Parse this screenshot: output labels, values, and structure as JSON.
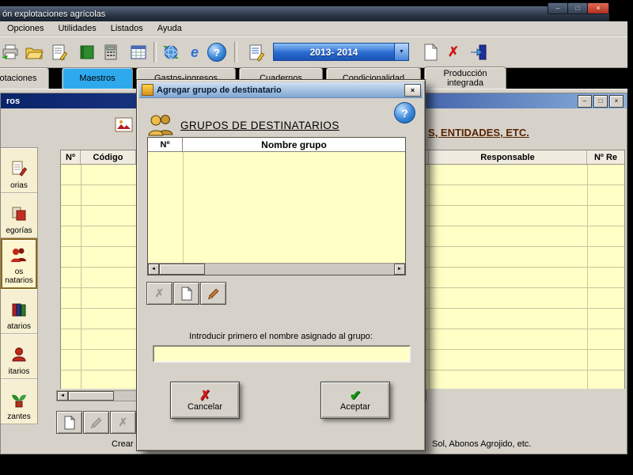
{
  "app": {
    "title": "ón explotaciones agrícolas",
    "menu": [
      "Opciones",
      "Utilidades",
      "Listados",
      "Ayuda"
    ],
    "toolbar": {
      "year_selector": "2013- 2014"
    },
    "tabs": [
      {
        "label": "otaciones"
      },
      {
        "label": "Maestros"
      },
      {
        "label": "Gastos-ingresos"
      },
      {
        "label": "Cuadernos"
      },
      {
        "label": "Condicionalidad"
      },
      {
        "label": "Producción integrada"
      }
    ],
    "active_tab": "Maestros"
  },
  "child": {
    "title": "ros",
    "heading": "S, ENTIDADES, ETC.",
    "table": {
      "headers": [
        "Nº",
        "Código",
        "Responsable",
        "Nº Re"
      ]
    },
    "sidebar": {
      "items": [
        {
          "label": "orias"
        },
        {
          "label": "egorías"
        },
        {
          "label": "os",
          "label2": "natarios",
          "selected": true
        },
        {
          "label": "atarios"
        },
        {
          "label": "itarios"
        },
        {
          "label": "zantes"
        }
      ]
    },
    "status_left": "Crear g",
    "status_right": "Sol, Abonos Agrojido, etc."
  },
  "dialog": {
    "title": "Agregar grupo de destinatario",
    "heading": "GRUPOS DE DESTINATARIOS",
    "grid": {
      "col_no": "Nº",
      "col_name": "Nombre grupo"
    },
    "instruction": "Introducir primero el nombre asignado al grupo:",
    "input_value": "",
    "buttons": {
      "cancel": "Cancelar",
      "accept": "Aceptar"
    }
  },
  "icons": {
    "min_glyph": "–",
    "max_glyph": "□",
    "close_glyph": "×",
    "help_glyph": "?",
    "ie_glyph": "e",
    "delete_glyph": "✗",
    "check_glyph": "✔",
    "left_arrow": "◄",
    "right_arrow": "►",
    "down_arrow": "▼"
  },
  "colors": {
    "active_tab_blue": "#2fa9ee",
    "table_yellow": "#ffffc6",
    "heading_maroon": "#5a2400",
    "year_selector_blue": "#2a6ad0",
    "close_button_red": "#c0392b",
    "child_titlebar_blue": "#0a246a"
  }
}
